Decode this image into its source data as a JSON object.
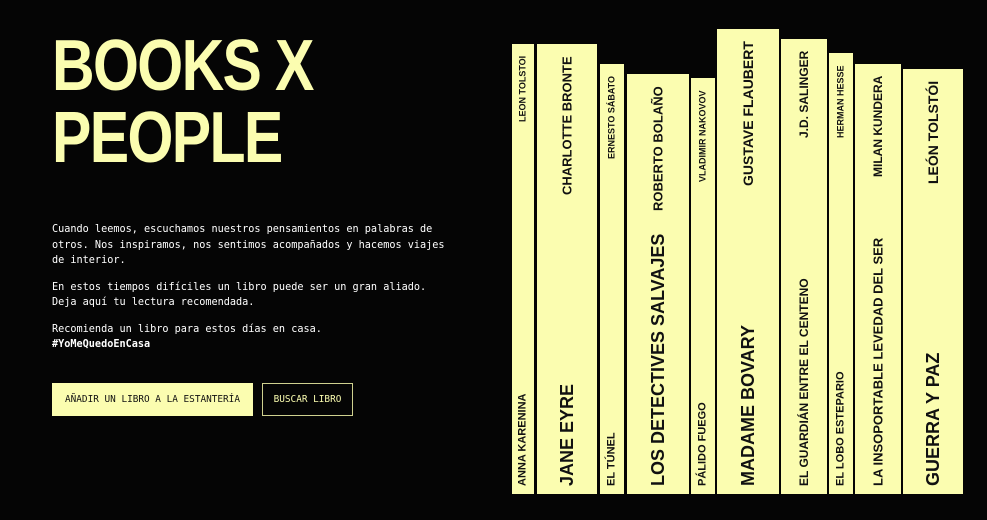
{
  "hero": {
    "title_line1": "BOOKS X",
    "title_line2": "PEOPLE",
    "paragraph1": "Cuando leemos, escuchamos nuestros pensamientos en palabras de otros. Nos inspiramos, nos sentimos acompañados y hacemos viajes de interior.",
    "paragraph2": "En estos tiempos difíciles un libro puede ser un gran aliado. Deja aquí tu lectura recomendada.",
    "paragraph3": "Recomienda un libro para estos días en casa.",
    "hashtag": "#YoMeQuedoEnCasa"
  },
  "actions": {
    "add_label": "AÑADIR UN LIBRO A LA ESTANTERÍA",
    "search_label": "BUSCAR LIBRO"
  },
  "colors": {
    "background": "#050505",
    "accent": "#fbfdb0"
  },
  "books": [
    {
      "title": "ANNA KARENINA",
      "author": "LEON TOLSTOI"
    },
    {
      "title": "JANE EYRE",
      "author": "CHARLOTTE BRONTE"
    },
    {
      "title": "EL TÚNEL",
      "author": "ERNESTO SÁBATO"
    },
    {
      "title": "LOS DETECTIVES SALVAJES",
      "author": "ROBERTO BOLAÑO"
    },
    {
      "title": "PÁLIDO FUEGO",
      "author": "VLADIMIR NAKOVOV"
    },
    {
      "title": "MADAME BOVARY",
      "author": "GUSTAVE FLAUBERT"
    },
    {
      "title": "EL GUARDIÁN ENTRE EL CENTENO",
      "author": "J.D. SALINGER"
    },
    {
      "title": "EL LOBO ESTEPARIO",
      "author": "HERMAN HESSE"
    },
    {
      "title": "LA INSOPORTABLE LEVEDAD DEL SER",
      "author": "MILAN KUNDERA"
    },
    {
      "title": "GUERRA Y PAZ",
      "author": "LEÓN TOLSTÓI"
    }
  ]
}
